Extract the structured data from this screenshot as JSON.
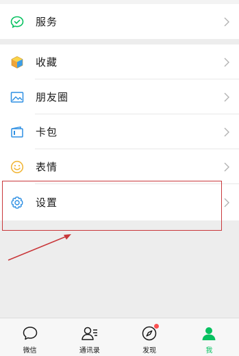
{
  "colors": {
    "accent": "#07c160",
    "highlight": "#c9373a",
    "badge": "#fa5151"
  },
  "menu_top": [
    {
      "label": "服务",
      "icon": "service-check-icon"
    }
  ],
  "menu_main": [
    {
      "label": "收藏",
      "icon": "favorites-cube-icon"
    },
    {
      "label": "朋友圈",
      "icon": "moments-photo-icon"
    },
    {
      "label": "卡包",
      "icon": "card-wallet-icon"
    },
    {
      "label": "表情",
      "icon": "sticker-smile-icon"
    },
    {
      "label": "设置",
      "icon": "gear-icon"
    }
  ],
  "tabbar": [
    {
      "label": "微信",
      "icon": "chat-bubble-icon",
      "active": false
    },
    {
      "label": "通讯录",
      "icon": "contacts-icon",
      "active": false
    },
    {
      "label": "发现",
      "icon": "compass-icon",
      "active": false,
      "badge": true
    },
    {
      "label": "我",
      "icon": "profile-person-icon",
      "active": true
    }
  ]
}
